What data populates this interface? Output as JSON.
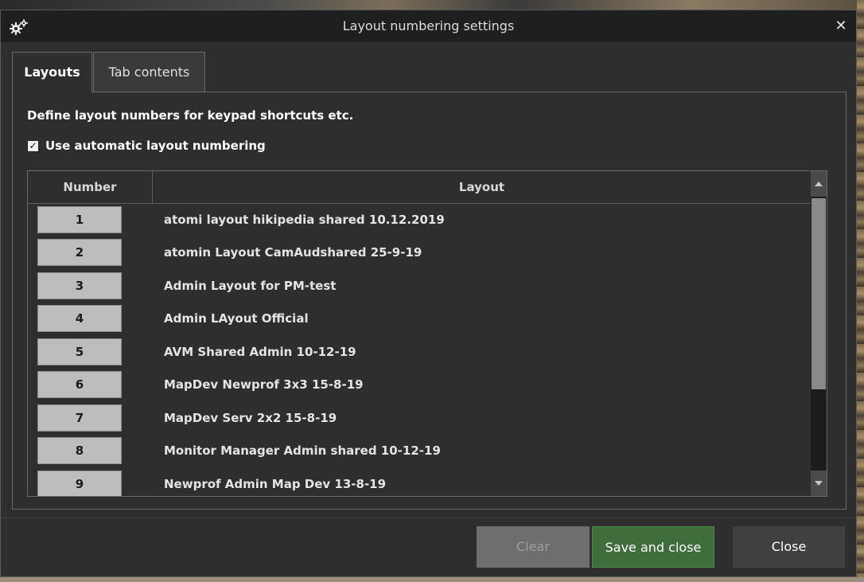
{
  "window": {
    "title": "Layout numbering settings",
    "close_glyph": "✕"
  },
  "tabs": [
    {
      "label": "Layouts",
      "active": true
    },
    {
      "label": "Tab contents",
      "active": false
    }
  ],
  "description": "Define layout numbers for keypad shortcuts etc.",
  "auto_numbering": {
    "label": "Use automatic layout numbering",
    "checked": true,
    "check_glyph": "✓"
  },
  "table": {
    "headers": {
      "number": "Number",
      "layout": "Layout"
    },
    "rows": [
      {
        "number": "1",
        "layout": "atomi layout hikipedia shared 10.12.2019"
      },
      {
        "number": "2",
        "layout": "atomin Layout CamAudshared 25-9-19"
      },
      {
        "number": "3",
        "layout": "Admin Layout for PM-test"
      },
      {
        "number": "4",
        "layout": "Admin LAyout Official"
      },
      {
        "number": "5",
        "layout": "AVM Shared Admin 10-12-19"
      },
      {
        "number": "6",
        "layout": "MapDev Newprof 3x3 15-8-19"
      },
      {
        "number": "7",
        "layout": "MapDev Serv 2x2 15-8-19"
      },
      {
        "number": "8",
        "layout": "Monitor Manager Admin shared  10-12-19"
      },
      {
        "number": "9",
        "layout": "Newprof Admin Map Dev 13-8-19"
      }
    ]
  },
  "buttons": {
    "clear": "Clear",
    "save": "Save and close",
    "close": "Close"
  },
  "colors": {
    "dialog_bg": "#2e2e2e",
    "save_button": "#3f6e3c",
    "clear_button_disabled": "#6e6e6e",
    "number_button": "#bdbdbd"
  },
  "icons": {
    "title": "gear-icon",
    "close": "close-icon",
    "scroll_up": "scroll-up-arrow-icon",
    "scroll_down": "scroll-down-arrow-icon"
  }
}
